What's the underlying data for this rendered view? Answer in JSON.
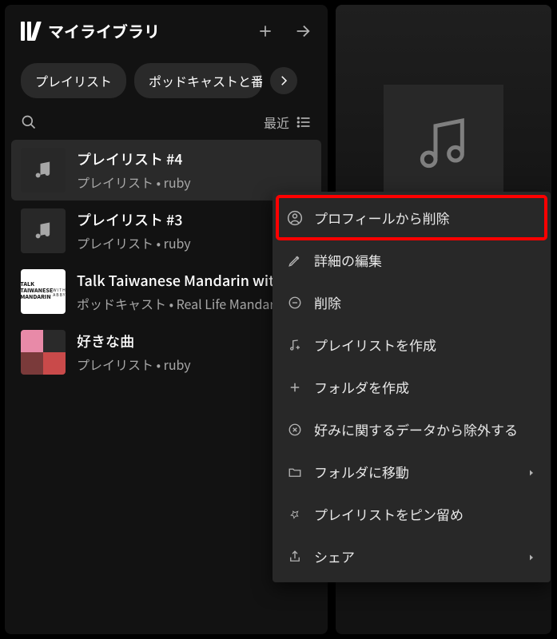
{
  "sidebar": {
    "title": "マイライブラリ",
    "chips": [
      {
        "label": "プレイリスト"
      },
      {
        "label": "ポッドキャストと番組"
      }
    ],
    "sort_label": "最近",
    "items": [
      {
        "title": "プレイリスト #4",
        "subtitle": "プレイリスト • ruby",
        "art": "music",
        "selected": true
      },
      {
        "title": "プレイリスト #3",
        "subtitle": "プレイリスト • ruby",
        "art": "music",
        "selected": false
      },
      {
        "title": "Talk Taiwanese Mandarin with Abby",
        "subtitle": "ポッドキャスト • Real Life Mandarin",
        "art": "podcast",
        "selected": false
      },
      {
        "title": "好きな曲",
        "subtitle": "プレイリスト • ruby",
        "art": "liked",
        "selected": false
      }
    ]
  },
  "context_menu": {
    "items": [
      {
        "icon": "profile",
        "label": "プロフィールから削除",
        "highlighted": true,
        "submenu": false
      },
      {
        "icon": "edit",
        "label": "詳細の編集",
        "highlighted": false,
        "submenu": false
      },
      {
        "icon": "minus-circle",
        "label": "削除",
        "highlighted": false,
        "submenu": false
      },
      {
        "icon": "playlist-add",
        "label": "プレイリストを作成",
        "highlighted": false,
        "submenu": false
      },
      {
        "icon": "plus",
        "label": "フォルダを作成",
        "highlighted": false,
        "submenu": false
      },
      {
        "icon": "x-circle",
        "label": "好みに関するデータから除外する",
        "highlighted": false,
        "submenu": false
      },
      {
        "icon": "folder",
        "label": "フォルダに移動",
        "highlighted": false,
        "submenu": true
      },
      {
        "icon": "pin",
        "label": "プレイリストをピン留め",
        "highlighted": false,
        "submenu": false
      },
      {
        "icon": "share",
        "label": "シェア",
        "highlighted": false,
        "submenu": true
      }
    ]
  }
}
